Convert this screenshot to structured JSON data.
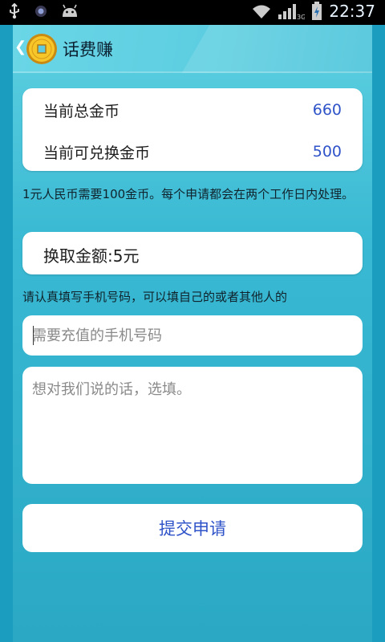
{
  "status_bar": {
    "time": "22:37",
    "icons": [
      "usb-icon",
      "camera-icon",
      "android-icon",
      "wifi-icon",
      "signal-3g-icon",
      "battery-icon"
    ],
    "network": "3G"
  },
  "header": {
    "title": "话费赚",
    "logo_icon": "coin-icon"
  },
  "summary": {
    "total_label": "当前总金币",
    "total_value": "660",
    "exchangeable_label": "当前可兑换金币",
    "exchangeable_value": "500"
  },
  "exchange_note": "1元人民币需要100金币。每个申请都会在两个工作日内处理。",
  "amount": {
    "text": "换取金额:5元"
  },
  "phone_note": "请认真填写手机号码，可以填自己的或者其他人的",
  "phone_input": {
    "placeholder": "需要充值的手机号码",
    "value": ""
  },
  "message_input": {
    "placeholder": "想对我们说的话，选填。",
    "value": ""
  },
  "submit": {
    "label": "提交申请"
  },
  "colors": {
    "accent_text": "#2f53c8",
    "background": "#2aa8c4",
    "header": "#5bcde0"
  }
}
